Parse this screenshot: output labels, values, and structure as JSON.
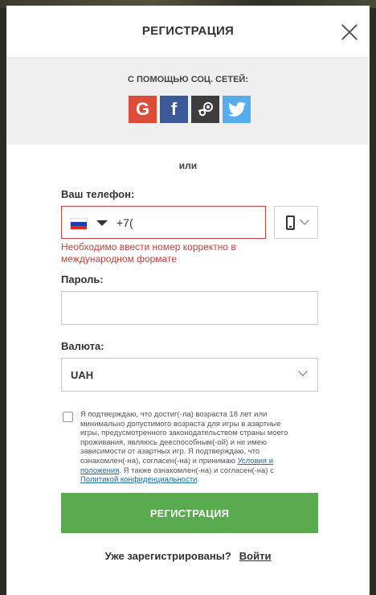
{
  "modal": {
    "title": "РЕГИСТРАЦИЯ"
  },
  "social": {
    "title": "С ПОМОЩЬЮ СОЦ. СЕТЕЙ:",
    "buttons": [
      {
        "icon": "google-icon",
        "glyph": "G",
        "color": "#dd4b39"
      },
      {
        "icon": "facebook-icon",
        "glyph": "f",
        "color": "#3b5998"
      },
      {
        "icon": "steam-icon",
        "color": "#3d3d3d"
      },
      {
        "icon": "twitter-icon",
        "color": "#55acee"
      }
    ]
  },
  "or_text": "или",
  "phone": {
    "label": "Ваш телефон:",
    "value": "+7(",
    "country_flag": "russia-flag-icon",
    "error": "Необходимо ввести номер корректно в международном формате"
  },
  "password": {
    "label": "Пароль:",
    "value": ""
  },
  "currency": {
    "label": "Валюта:",
    "selected": "UAH"
  },
  "terms": {
    "text_1": "Я подтверждаю, что достиг(-ла) возраста 18 лет или минимально допустимого возраста для игры в азартные игры, предусмотренного законодательством страны моего проживания, являюсь дееспособным(-ой) и не имею зависимости от азартных игр. Я подтверждаю, что ознакомлен(-на), согласен(-на) и принимаю ",
    "link_1": "Условия и положения",
    "text_2": ". Я также ознакомлен(-на) и согласен(-на) с ",
    "link_2": "Политикой конфиденциальности",
    "text_3": "."
  },
  "submit_label": "РЕГИСТРАЦИЯ",
  "login": {
    "prompt": "Уже зарегистрированы?",
    "link": "Войти"
  },
  "colors": {
    "accent_green": "#5aaa4f",
    "error_red": "#c9403c",
    "link_blue": "#1b6ea8"
  }
}
